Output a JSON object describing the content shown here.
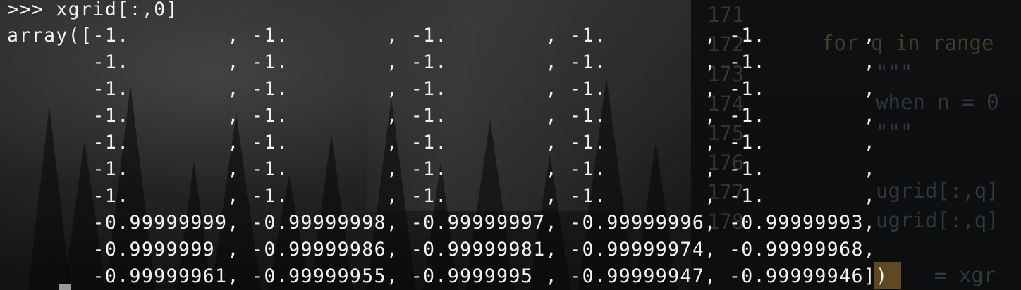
{
  "terminal": {
    "lines": [
      ">>> xgrid[:,0]",
      "array([-1.        , -1.        , -1.        , -1.        , -1.        ,",
      "       -1.        , -1.        , -1.        , -1.        , -1.        ,",
      "       -1.        , -1.        , -1.        , -1.        , -1.        ,",
      "       -1.        , -1.        , -1.        , -1.        , -1.        ,",
      "       -1.        , -1.        , -1.        , -1.        , -1.        ,",
      "       -1.        , -1.        , -1.        , -1.        , -1.        ,",
      "       -1.        , -1.        , -1.        , -1.        , -1.        ,",
      "       -0.99999999, -0.99999998, -0.99999997, -0.99999996, -0.99999993,",
      "       -0.9999999 , -0.99999986, -0.99999981, -0.99999974, -0.99999968,",
      "       -0.99999961, -0.99999955, -0.9999995 , -0.99999947, -0.99999946])"
    ]
  },
  "editor": {
    "line_numbers": [
      "171",
      "172",
      "173",
      "174",
      "175",
      "176",
      "177",
      "178"
    ],
    "code": {
      "for_loop": "for q in range",
      "docstring_open": "\"\"\"",
      "when_text": "when n = 0",
      "docstring_close": "\"\"\"",
      "ugrid_1": "ugrid[:,q]",
      "ugrid_2": "ugrid[:,q]",
      "xgr": "= xgr"
    }
  },
  "colors": {
    "terminal_text": "#f2f2f2",
    "editor_background": "#0c0e10",
    "highlight": "#785f28"
  }
}
